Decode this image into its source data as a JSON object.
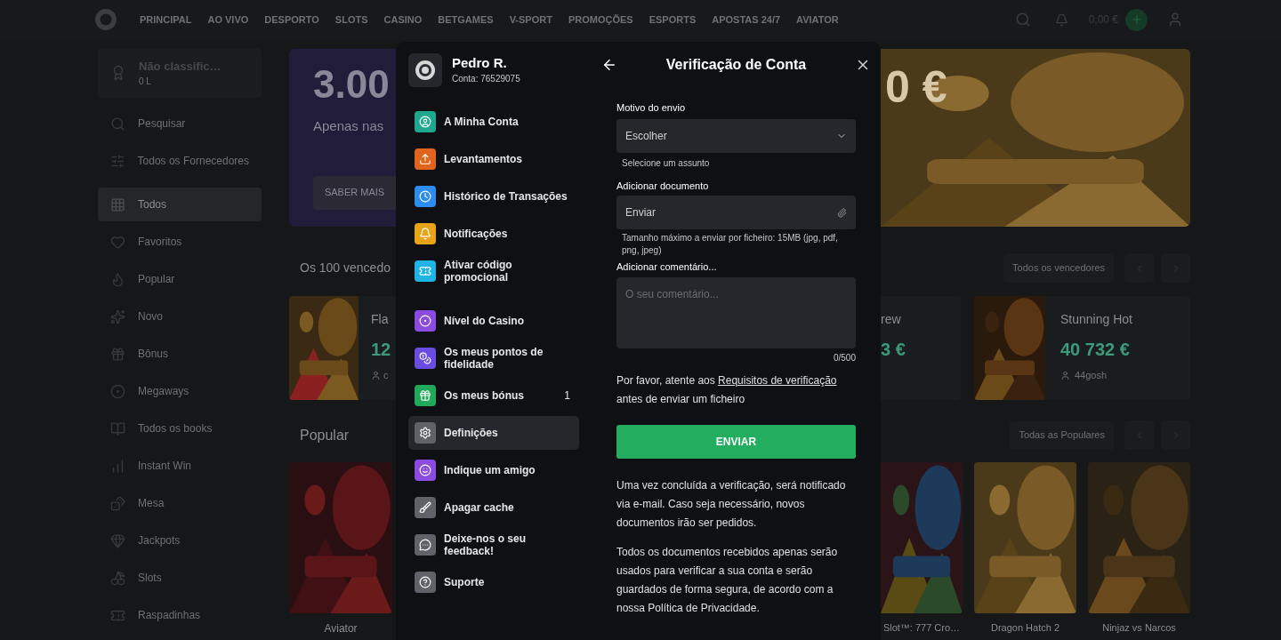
{
  "nav": {
    "items": [
      {
        "label": "PRINCIPAL"
      },
      {
        "label": "AO VIVO"
      },
      {
        "label": "DESPORTO"
      },
      {
        "label": "SLOTS"
      },
      {
        "label": "CASINO"
      },
      {
        "label": "BETGAMES"
      },
      {
        "label": "V-SPORT"
      },
      {
        "label": "PROMOÇÕES"
      },
      {
        "label": "ESPORTS"
      },
      {
        "label": "APOSTAS 24/7"
      },
      {
        "label": "AVIATOR"
      }
    ],
    "balance": "0,00 €"
  },
  "sidebar": {
    "rank": {
      "title": "Não classific…",
      "points": "0 L"
    },
    "items": [
      {
        "label": "Pesquisar",
        "selected": false
      },
      {
        "label": "Todos os Fornecedores",
        "selected": false
      },
      {
        "label": "Todos",
        "selected": true
      },
      {
        "label": "Favoritos",
        "selected": false
      },
      {
        "label": "Popular",
        "selected": false
      },
      {
        "label": "Novo",
        "selected": false
      },
      {
        "label": "Bônus",
        "selected": false
      },
      {
        "label": "Megaways",
        "selected": false
      },
      {
        "label": "Todos os books",
        "selected": false
      },
      {
        "label": "Instant Win",
        "selected": false
      },
      {
        "label": "Mesa",
        "selected": false
      },
      {
        "label": "Jackpots",
        "selected": false
      },
      {
        "label": "Slots",
        "selected": false
      },
      {
        "label": "Raspadinhas",
        "selected": false
      }
    ]
  },
  "main": {
    "banner_left": {
      "amount": "3.00",
      "text": "Apenas nas",
      "button": "SABER MAIS"
    },
    "banner_right": {
      "amount": "0 €"
    },
    "winners": {
      "title": "Os 100 vencedo",
      "all": "Todos os vencedores",
      "left_card": {
        "game": "Fla",
        "amount": "12",
        "user": "c"
      },
      "cards": [
        {
          "game": "rew",
          "amount": "3 €"
        },
        {
          "game": "Stunning Hot",
          "amount": "40 732 €",
          "user": "44gosh"
        }
      ]
    },
    "popular": {
      "title": "Popular",
      "all": "Todas as Populares",
      "left_tiles": [
        {
          "title": "Aviator"
        }
      ],
      "tiles": [
        {
          "title": "Slot™: 777 Cro…"
        },
        {
          "title": "Dragon Hatch 2"
        },
        {
          "title": "Ninjaz vs Narcos"
        }
      ]
    }
  },
  "modal": {
    "user": {
      "name": "Pedro R.",
      "account": "Conta: 76529075"
    },
    "menu": [
      {
        "label": "A Minha Conta",
        "color": "#1fa88f",
        "selected": false
      },
      {
        "label": "Levantamentos",
        "color": "#e0641b",
        "selected": false
      },
      {
        "label": "Histórico de Transações",
        "color": "#2d8cf0",
        "selected": false
      },
      {
        "label": "Notificações",
        "color": "#e8a317",
        "selected": false
      },
      {
        "label": "Ativar código promocional",
        "color": "#1eb4e6",
        "selected": false
      },
      {
        "label": "Nível do Casino",
        "color": "#8c4be0",
        "selected": false
      },
      {
        "label": "Os meus pontos de fidelidade",
        "color": "#6a4de0",
        "selected": false
      },
      {
        "label": "Os meus bónus",
        "color": "#21a85a",
        "selected": false,
        "badge": "1"
      },
      {
        "label": "Definições",
        "color": "#5f6369",
        "selected": true
      },
      {
        "label": "Indique um amigo",
        "color": "#8c4be0",
        "selected": false
      },
      {
        "label": "Apagar cache",
        "color": "#5f6369",
        "selected": false
      },
      {
        "label": "Deixe-nos o seu feedback!",
        "color": "#5f6369",
        "selected": false
      },
      {
        "label": "Suporte",
        "color": "#5f6369",
        "selected": false
      }
    ],
    "panel": {
      "title": "Verificação de Conta",
      "reason": {
        "label": "Motivo do envio",
        "value": "Escolher",
        "hint": "Selecione um assunto"
      },
      "document": {
        "label": "Adicionar documento",
        "value": "Enviar",
        "hint": "Tamanho máximo a enviar por ficheiro: 15MB (jpg, pdf, png, jpeg)"
      },
      "comment": {
        "label": "Adicionar comentário...",
        "placeholder": "O seu comentário...",
        "counter": "0/500"
      },
      "notice": "Por favor, atente aos ",
      "notice_link": "Requisitos de verificação",
      "notice_end": " antes de enviar um ficheiro",
      "submit": "ENVIAR",
      "paragraphs": [
        "Uma vez concluída a verificação, será notificado via e-mail. Caso seja necessário, novos documentos irão ser pedidos.",
        "Todos os documentos recebidos apenas serão usados para verificar a sua conta e serão guardados de forma segura, de acordo com a nossa Política de Privacidade."
      ]
    }
  }
}
